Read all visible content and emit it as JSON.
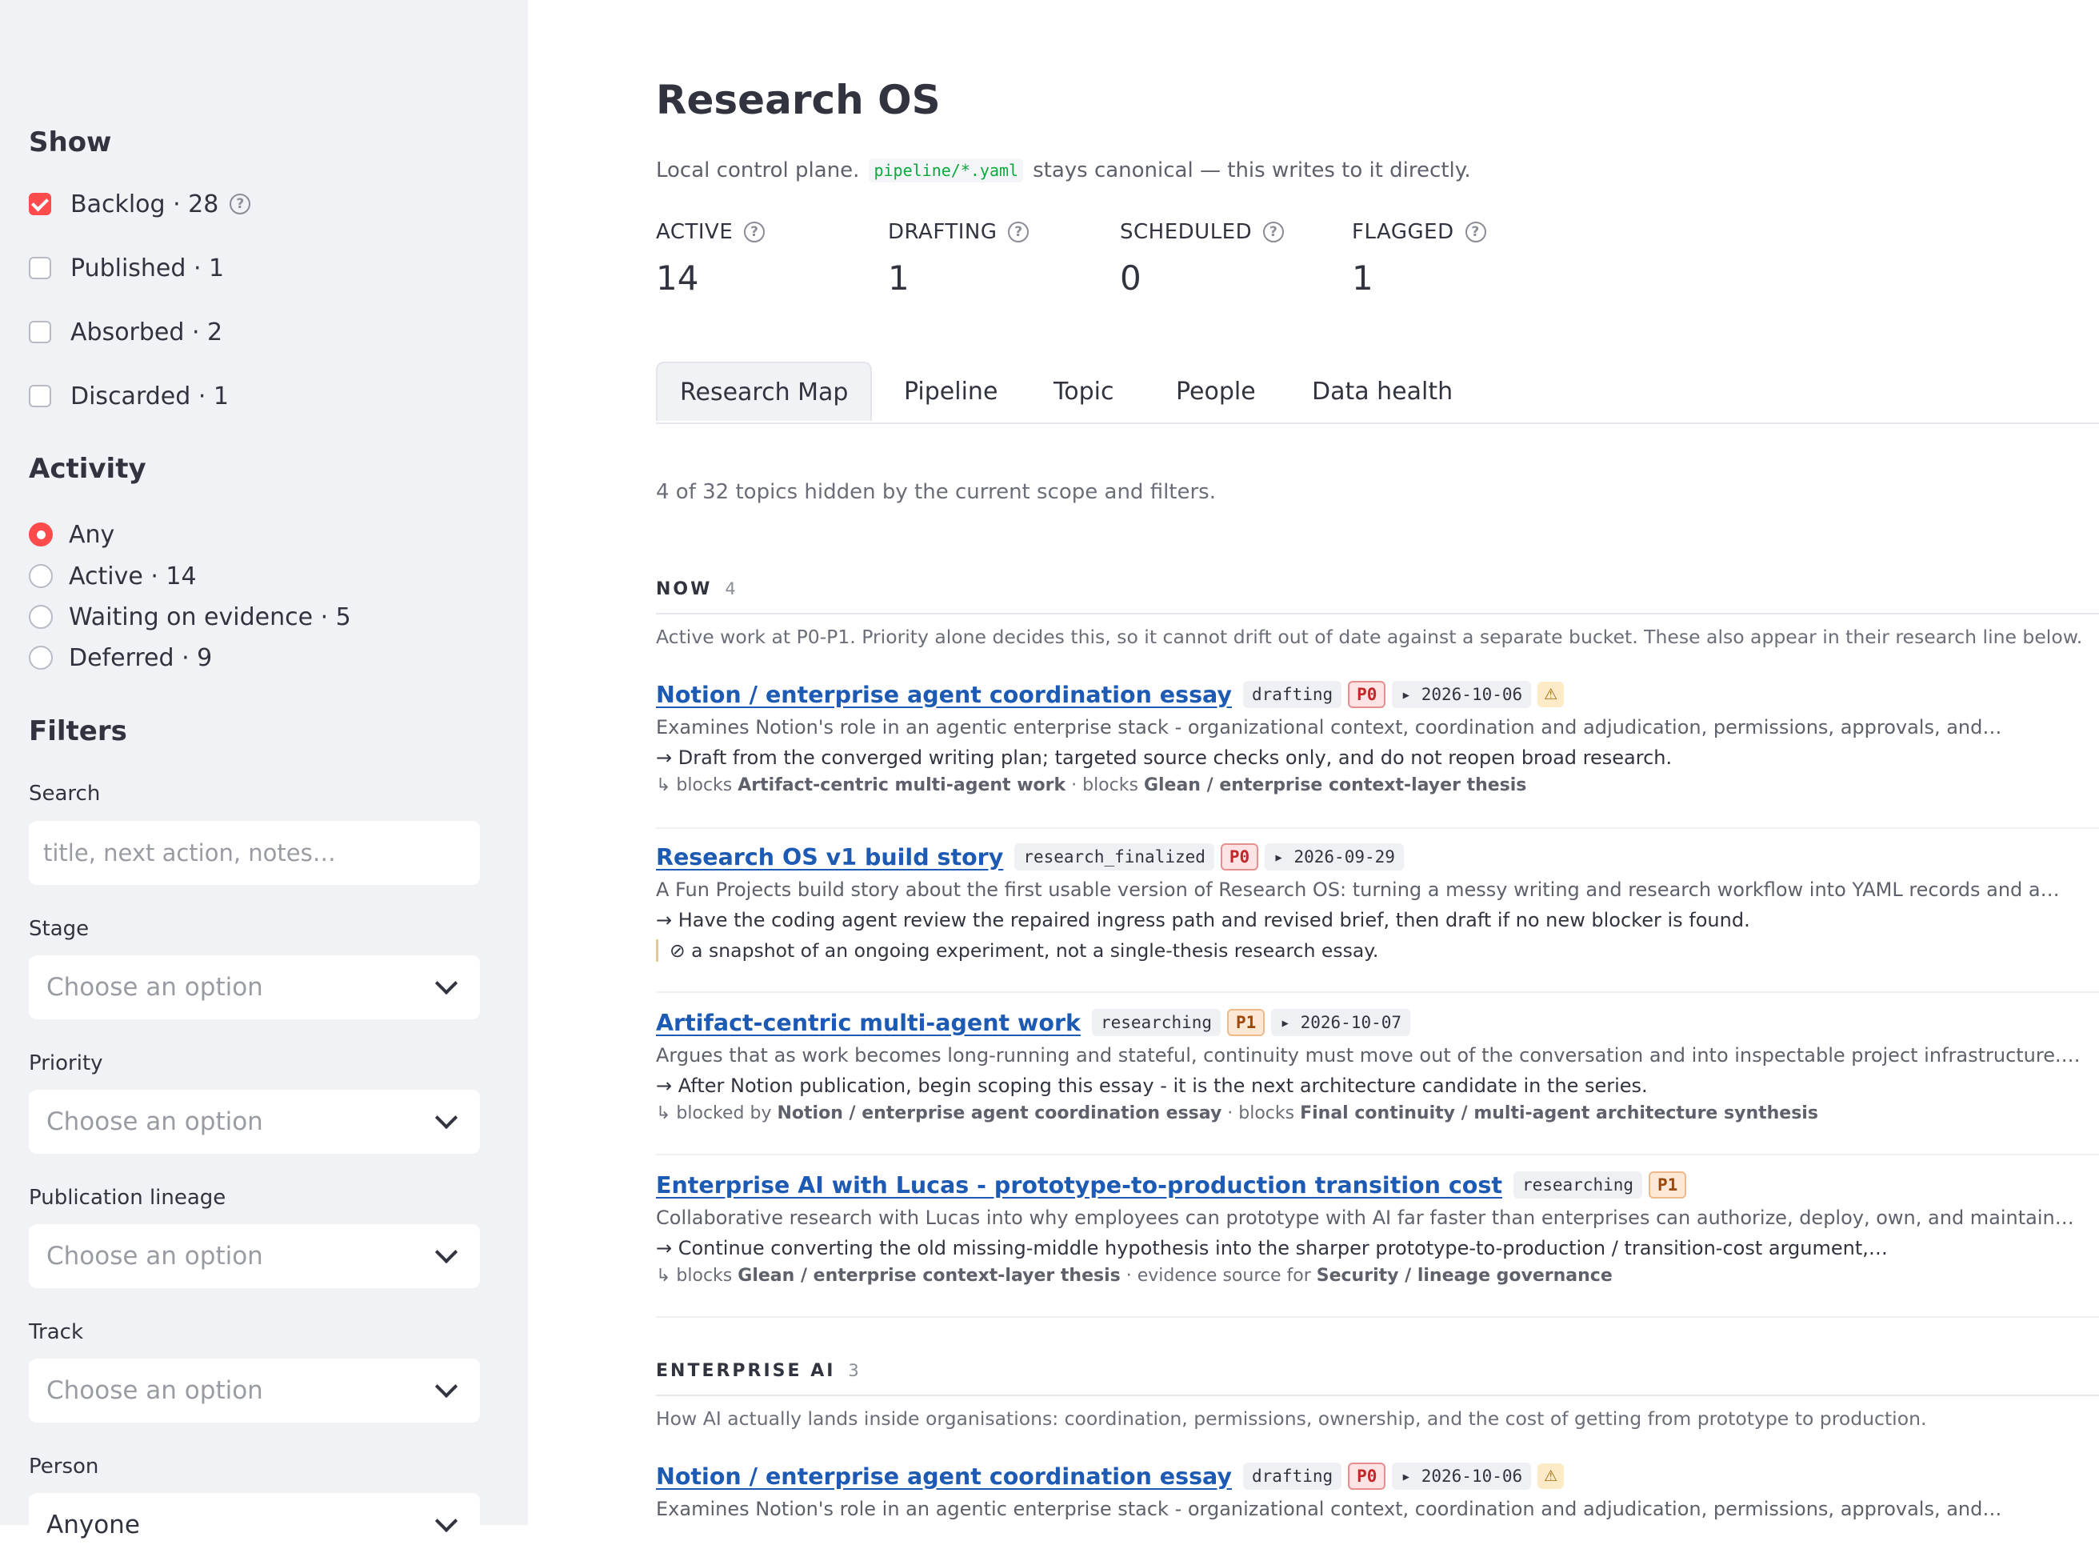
{
  "sidebar": {
    "show_heading": "Show",
    "show_options": [
      {
        "label": "Backlog · 28",
        "checked": true,
        "help": true
      },
      {
        "label": "Published · 1",
        "checked": false
      },
      {
        "label": "Absorbed · 2",
        "checked": false
      },
      {
        "label": "Discarded · 1",
        "checked": false
      }
    ],
    "activity_heading": "Activity",
    "activity_options": [
      {
        "label": "Any",
        "selected": true
      },
      {
        "label": "Active · 14",
        "selected": false
      },
      {
        "label": "Waiting on evidence · 5",
        "selected": false
      },
      {
        "label": "Deferred · 9",
        "selected": false
      }
    ],
    "filters_heading": "Filters",
    "search": {
      "label": "Search",
      "placeholder": "title, next action, notes…"
    },
    "stage": {
      "label": "Stage",
      "value": "Choose an option"
    },
    "priority": {
      "label": "Priority",
      "value": "Choose an option"
    },
    "lineage": {
      "label": "Publication lineage",
      "value": "Choose an option"
    },
    "track": {
      "label": "Track",
      "value": "Choose an option"
    },
    "person": {
      "label": "Person",
      "value": "Anyone"
    }
  },
  "header": {
    "title": "Research OS",
    "subtitle_before": "Local control plane.",
    "subtitle_code": "pipeline/*.yaml",
    "subtitle_after": "stays canonical — this writes to it directly."
  },
  "metrics": [
    {
      "label": "ACTIVE",
      "value": "14"
    },
    {
      "label": "DRAFTING",
      "value": "1"
    },
    {
      "label": "SCHEDULED",
      "value": "0"
    },
    {
      "label": "FLAGGED",
      "value": "1"
    }
  ],
  "tabs": [
    "Research Map",
    "Pipeline",
    "Topic",
    "People",
    "Data health"
  ],
  "active_tab": "Research Map",
  "scope_note": "4 of 32 topics hidden by the current scope and filters.",
  "sections": [
    {
      "title": "NOW",
      "count": "4",
      "description": "Active work at P0-P1. Priority alone decides this, so it cannot drift out of date against a separate bucket. These also appear in their research line below.",
      "items": [
        {
          "title": "Notion / enterprise agent coordination essay",
          "stage": "drafting",
          "priority": "P0",
          "date": "▸ 2026-10-06",
          "warn": "⚠",
          "summary": "Examines Notion's role in an agentic enterprise stack - organizational context, coordination and adjudication, permissions, approvals, and…",
          "next": "→ Draft from the converged writing plan; targeted source checks only, and do not reopen broad research.",
          "deps_prefix": "↳ blocks ",
          "deps_b1": "Artifact-centric multi-agent work",
          "deps_mid": " · blocks ",
          "deps_b2": "Glean / enterprise context-layer thesis"
        },
        {
          "title": "Research OS v1 build story",
          "stage": "research_finalized",
          "priority": "P0",
          "date": "▸ 2026-09-29",
          "summary": "A Fun Projects build story about the first usable version of Research OS: turning a messy writing and research workflow into YAML records and a…",
          "next": "→ Have the coding agent review the repaired ingress path and revised brief, then draft if no new blocker is found.",
          "quote": "⊘ a snapshot of an ongoing experiment, not a single-thesis research essay."
        },
        {
          "title": "Artifact-centric multi-agent work",
          "stage": "researching",
          "priority": "P1",
          "date": "▸ 2026-10-07",
          "summary": "Argues that as work becomes long-running and stateful, continuity must move out of the conversation and into inspectable project infrastructure.…",
          "next": "→ After Notion publication, begin scoping this essay - it is the next architecture candidate in the series.",
          "deps_prefix": "↳ blocked by ",
          "deps_b1": "Notion / enterprise agent coordination essay",
          "deps_mid": " · blocks ",
          "deps_b2": "Final continuity / multi-agent architecture synthesis"
        },
        {
          "title": "Enterprise AI with Lucas - prototype-to-production transition cost",
          "stage": "researching",
          "priority": "P1",
          "summary": "Collaborative research with Lucas into why employees can prototype with AI far faster than enterprises can authorize, deploy, own, and maintain…",
          "next": "→ Continue converting the old missing-middle hypothesis into the sharper prototype-to-production / transition-cost argument,…",
          "deps_prefix": "↳ blocks ",
          "deps_b1": "Glean / enterprise context-layer thesis",
          "deps_mid": " · evidence source for ",
          "deps_b2": "Security / lineage governance"
        }
      ]
    },
    {
      "title": "ENTERPRISE AI",
      "count": "3",
      "description": "How AI actually lands inside organisations: coordination, permissions, ownership, and the cost of getting from prototype to production.",
      "items": [
        {
          "title": "Notion / enterprise agent coordination essay",
          "stage": "drafting",
          "priority": "P0",
          "date": "▸ 2026-10-06",
          "warn": "⚠",
          "summary": "Examines Notion's role in an agentic enterprise stack - organizational context, coordination and adjudication, permissions, approvals, and…"
        }
      ]
    }
  ],
  "colors": {
    "accent": "#ff4b4b",
    "link": "#1c5ab4",
    "sidebar_bg": "#f0f2f6"
  }
}
